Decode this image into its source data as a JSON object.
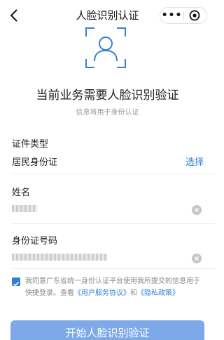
{
  "nav": {
    "back_icon": "chevron-left-icon",
    "title": "人脸识别认证",
    "more_icon": "more-icon",
    "close_icon": "target-close-icon"
  },
  "header": {
    "headline": "当前业务需要人脸识别验证",
    "subline": "信息将用于身份认证"
  },
  "form": {
    "cert_type_label": "证件类型",
    "cert_type_value": "居民身份证",
    "cert_type_action": "选择",
    "name_label": "姓名",
    "id_label": "身份证号码"
  },
  "agreement": {
    "checked": true,
    "text_before": "我同意广东省统一身份认证平台使用我所提交的信息用于快捷登录。查看",
    "link1": "《用户服务协议》",
    "and": "和",
    "link2": "《隐私政策》"
  },
  "button": {
    "start_label": "开始人脸识别验证"
  },
  "colors": {
    "accent": "#2f7fd6",
    "button": "#7ea9e9"
  }
}
